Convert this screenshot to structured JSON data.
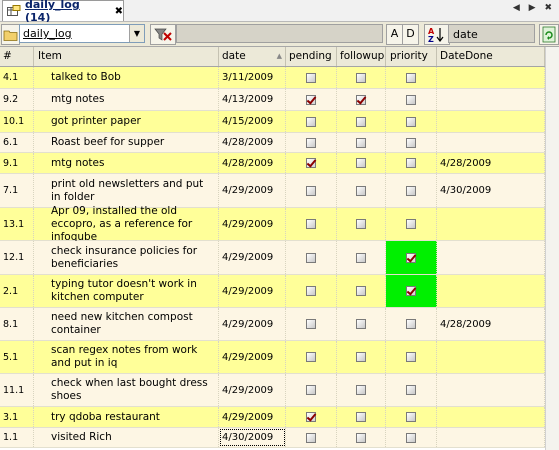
{
  "tab": {
    "label": "daily_log (14)",
    "close": "✖",
    "nav": "◀ ▶ ✖"
  },
  "toolbar": {
    "table_name": "daily_log",
    "sort_asc_label": "A",
    "sort_desc_label": "D",
    "sort_field": "date"
  },
  "columns": {
    "num": "#",
    "item": "Item",
    "date": "date",
    "pending": "pending",
    "followup": "followup",
    "priority": "priority",
    "done": "DateDone"
  },
  "rows": [
    {
      "num": "4.1",
      "item": "talked to Bob",
      "date": "3/11/2009",
      "pending": false,
      "followup": false,
      "priority": false,
      "done": ""
    },
    {
      "num": "9.2",
      "item": "mtg notes",
      "date": "4/13/2009",
      "pending": true,
      "followup": true,
      "priority": false,
      "done": ""
    },
    {
      "num": "10.1",
      "item": "got printer paper",
      "date": "4/15/2009",
      "pending": false,
      "followup": false,
      "priority": false,
      "done": ""
    },
    {
      "num": "6.1",
      "item": "Roast beef for supper",
      "date": "4/28/2009",
      "pending": false,
      "followup": false,
      "priority": false,
      "done": ""
    },
    {
      "num": "9.1",
      "item": "mtg notes",
      "date": "4/28/2009",
      "pending": true,
      "followup": false,
      "priority": false,
      "done": "4/28/2009"
    },
    {
      "num": "7.1",
      "item": "print old newsletters and put in folder",
      "date": "4/29/2009",
      "pending": false,
      "followup": false,
      "priority": false,
      "done": "4/30/2009"
    },
    {
      "num": "13.1",
      "item": "Apr 09, installed the old eccopro, as a reference for infoqube",
      "date": "4/29/2009",
      "pending": false,
      "followup": false,
      "priority": false,
      "done": ""
    },
    {
      "num": "12.1",
      "item": "check insurance policies for beneficiaries",
      "date": "4/29/2009",
      "pending": false,
      "followup": false,
      "priority": true,
      "done": ""
    },
    {
      "num": "2.1",
      "item": "typing tutor doesn't work in kitchen computer",
      "date": "4/29/2009",
      "pending": false,
      "followup": false,
      "priority": true,
      "done": ""
    },
    {
      "num": "8.1",
      "item": "need new kitchen compost container",
      "date": "4/29/2009",
      "pending": false,
      "followup": false,
      "priority": false,
      "done": "4/28/2009"
    },
    {
      "num": "5.1",
      "item": "scan regex notes from work and put in iq",
      "date": "4/29/2009",
      "pending": false,
      "followup": false,
      "priority": false,
      "done": ""
    },
    {
      "num": "11.1",
      "item": "check when last bought dress shoes",
      "date": "4/29/2009",
      "pending": false,
      "followup": false,
      "priority": false,
      "done": ""
    },
    {
      "num": "3.1",
      "item": "try qdoba restaurant",
      "date": "4/29/2009",
      "pending": true,
      "followup": false,
      "priority": false,
      "done": ""
    },
    {
      "num": "1.1",
      "item": "visited Rich",
      "date": "4/30/2009",
      "pending": false,
      "followup": false,
      "priority": false,
      "done": ""
    }
  ],
  "colors": {
    "highlight_row": "#ffff99",
    "alt_row": "#fdf6e4",
    "priority_on": "#00f000",
    "check": "#8b0000"
  }
}
